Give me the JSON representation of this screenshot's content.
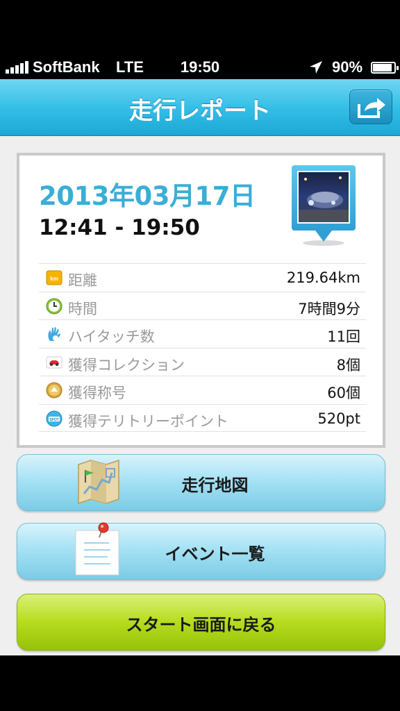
{
  "status_bar": {
    "carrier": "SoftBank",
    "network": "LTE",
    "time": "19:50",
    "battery": "90%",
    "battery_level": 0.9,
    "icons": [
      "signal-icon",
      "location-arrow-icon",
      "battery-icon"
    ]
  },
  "nav": {
    "title": "走行レポート",
    "share_icon": "share-icon"
  },
  "report": {
    "date": "2013年03月17日",
    "time_range": "12:41 - 19:50",
    "stats": [
      {
        "icon": "km-icon",
        "label": "距離",
        "value": "219.64km"
      },
      {
        "icon": "clock-icon",
        "label": "時間",
        "value": "7時間9分"
      },
      {
        "icon": "high-touch-hand-icon",
        "label": "ハイタッチ数",
        "value": "11回"
      },
      {
        "icon": "car-card-icon",
        "label": "獲得コレクション",
        "value": "8個"
      },
      {
        "icon": "title-medal-icon",
        "label": "獲得称号",
        "value": "60個"
      },
      {
        "icon": "spot-icon",
        "label": "獲得テリトリーポイント",
        "value": "520pt"
      }
    ]
  },
  "buttons": {
    "map": "走行地図",
    "events": "イベント一覧",
    "start": "スタート画面に戻る"
  },
  "colors": {
    "accent": "#3aaed6",
    "nav": "#35bfe7",
    "start_button": "#b6dc1c"
  }
}
